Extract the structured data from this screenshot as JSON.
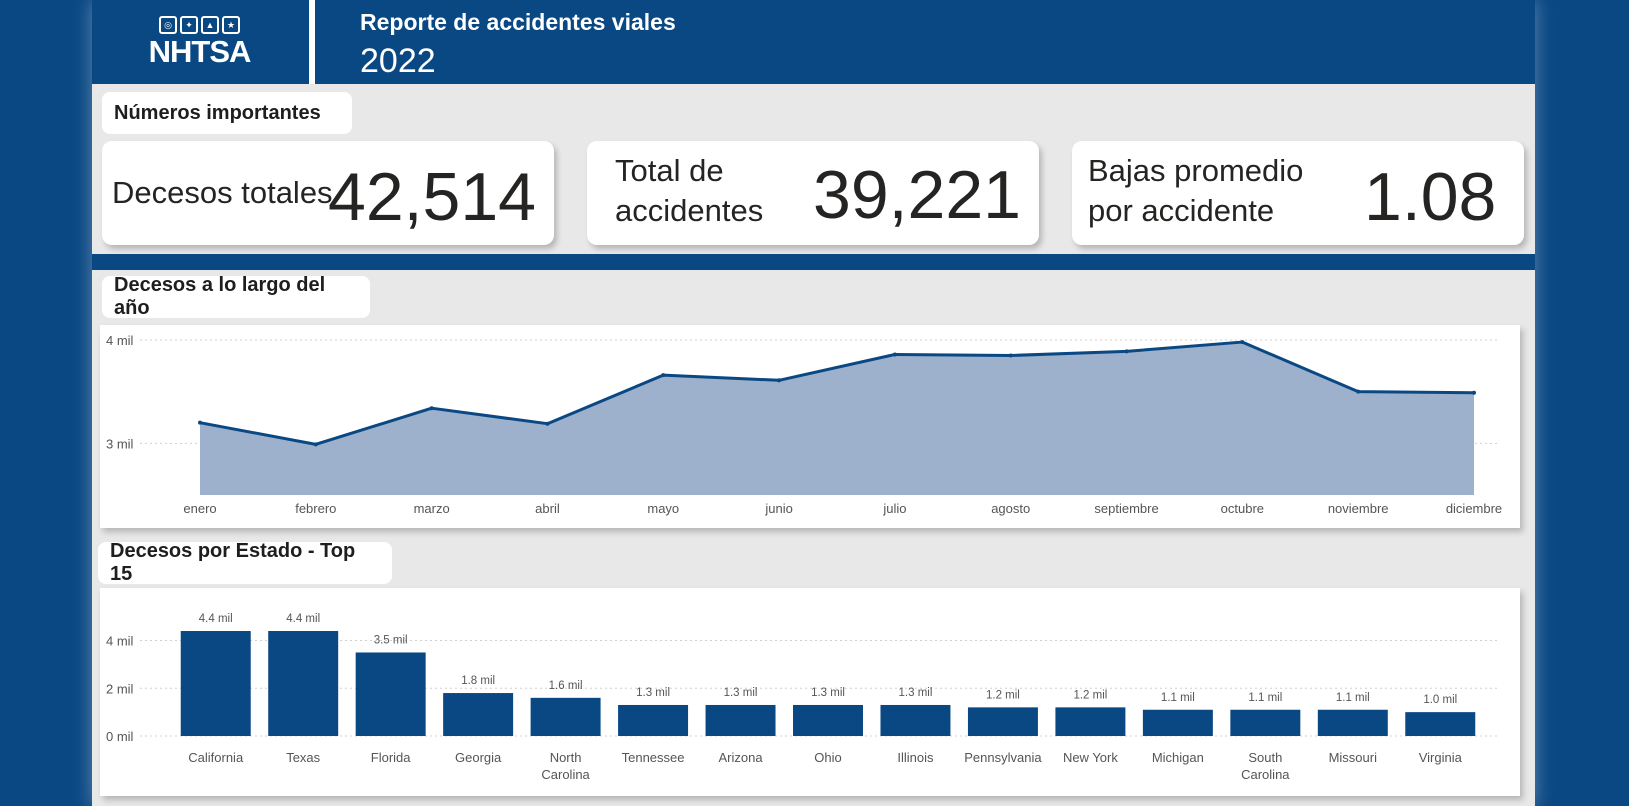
{
  "header": {
    "logo_text": "NHTSA",
    "title": "Reporte de accidentes viales",
    "year": "2022"
  },
  "sections": {
    "kpis_label": "Números importantes",
    "line_label": "Decesos a lo largo del año",
    "bar_label": "Decesos por Estado - Top 15"
  },
  "kpis": [
    {
      "label_lines": [
        "Decesos totales"
      ],
      "value": "42,514"
    },
    {
      "label_lines": [
        "Total de",
        "accidentes"
      ],
      "value": "39,221"
    },
    {
      "label_lines": [
        "Bajas promedio",
        "por accidente"
      ],
      "value": "1.08"
    }
  ],
  "colors": {
    "navy": "#0a4884",
    "area_fill": "#9db1cc",
    "line": "#0a4884"
  },
  "chart_data": [
    {
      "type": "area",
      "categories": [
        "enero",
        "febrero",
        "marzo",
        "abril",
        "mayo",
        "junio",
        "julio",
        "agosto",
        "septiembre",
        "octubre",
        "noviembre",
        "diciembre"
      ],
      "values": [
        3200,
        2990,
        3340,
        3190,
        3660,
        3610,
        3860,
        3850,
        3890,
        3980,
        3500,
        3490
      ],
      "yticks": [
        {
          "value": 3000,
          "label": "3 mil"
        },
        {
          "value": 4000,
          "label": "4 mil"
        }
      ],
      "ylim": [
        2500,
        4000
      ],
      "grid": true
    },
    {
      "type": "bar",
      "categories": [
        [
          "California"
        ],
        [
          "Texas"
        ],
        [
          "Florida"
        ],
        [
          "Georgia"
        ],
        [
          "North",
          "Carolina"
        ],
        [
          "Tennessee"
        ],
        [
          "Arizona"
        ],
        [
          "Ohio"
        ],
        [
          "Illinois"
        ],
        [
          "Pennsylvania"
        ],
        [
          "New York"
        ],
        [
          "Michigan"
        ],
        [
          "South",
          "Carolina"
        ],
        [
          "Missouri"
        ],
        [
          "Virginia"
        ]
      ],
      "values": [
        4.4,
        4.4,
        3.5,
        1.8,
        1.6,
        1.3,
        1.3,
        1.3,
        1.3,
        1.2,
        1.2,
        1.1,
        1.1,
        1.1,
        1.0
      ],
      "data_labels": [
        "4.4 mil",
        "4.4 mil",
        "3.5 mil",
        "1.8 mil",
        "1.6 mil",
        "1.3 mil",
        "1.3 mil",
        "1.3 mil",
        "1.3 mil",
        "1.2 mil",
        "1.2 mil",
        "1.1 mil",
        "1.1 mil",
        "1.1 mil",
        "1.0 mil"
      ],
      "yticks": [
        {
          "value": 0,
          "label": "0 mil"
        },
        {
          "value": 2,
          "label": "2 mil"
        },
        {
          "value": 4,
          "label": "4 mil"
        }
      ],
      "ylim": [
        0,
        4.4
      ],
      "grid": true
    }
  ]
}
